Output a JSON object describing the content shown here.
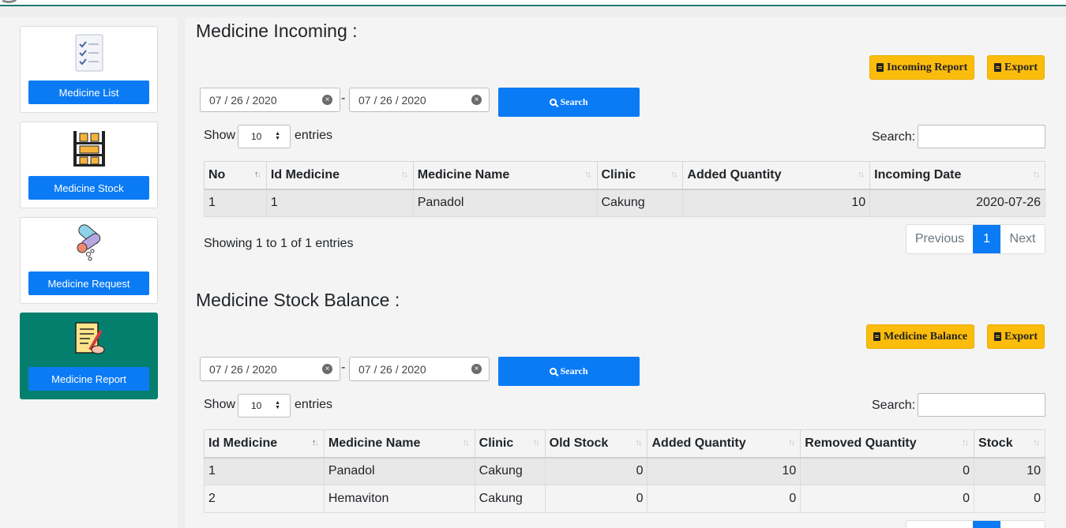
{
  "sidebar": {
    "items": [
      {
        "label": "Medicine List",
        "icon": "checklist-icon"
      },
      {
        "label": "Medicine Stock",
        "icon": "shelf-icon"
      },
      {
        "label": "Medicine Request",
        "icon": "pills-icon"
      },
      {
        "label": "Medicine Report",
        "icon": "report-icon",
        "active": true
      }
    ]
  },
  "incoming": {
    "title": "Medicine Incoming :",
    "report_button": "Incoming Report",
    "export_button": "Export",
    "date_from": "07 / 26 / 2020",
    "date_to": "07 / 26 / 2020",
    "search_button": "Search",
    "show_label": "Show",
    "entries_value": "10",
    "entries_label": "entries",
    "search_label": "Search:",
    "columns": [
      "No",
      "Id Medicine",
      "Medicine Name",
      "Clinic",
      "Added Quantity",
      "Incoming Date"
    ],
    "rows": [
      [
        "1",
        "1",
        "Panadol",
        "Cakung",
        "10",
        "2020-07-26"
      ]
    ],
    "info": "Showing 1 to 1 of 1 entries",
    "pager": {
      "previous": "Previous",
      "page": "1",
      "next": "Next"
    }
  },
  "balance": {
    "title": "Medicine Stock Balance :",
    "report_button": "Medicine Balance",
    "export_button": "Export",
    "date_from": "07 / 26 / 2020",
    "date_to": "07 / 26 / 2020",
    "search_button": "Search",
    "show_label": "Show",
    "entries_value": "10",
    "entries_label": "entries",
    "search_label": "Search:",
    "columns": [
      "Id Medicine",
      "Medicine Name",
      "Clinic",
      "Old Stock",
      "Added Quantity",
      "Removed Quantity",
      "Stock"
    ],
    "rows": [
      [
        "1",
        "Panadol",
        "Cakung",
        "0",
        "10",
        "0",
        "10"
      ],
      [
        "2",
        "Hemaviton",
        "Cakung",
        "0",
        "0",
        "0",
        "0"
      ]
    ]
  },
  "colors": {
    "primary": "#0b7bf5",
    "warning": "#fcbc0c",
    "active_card": "#047f6e"
  }
}
